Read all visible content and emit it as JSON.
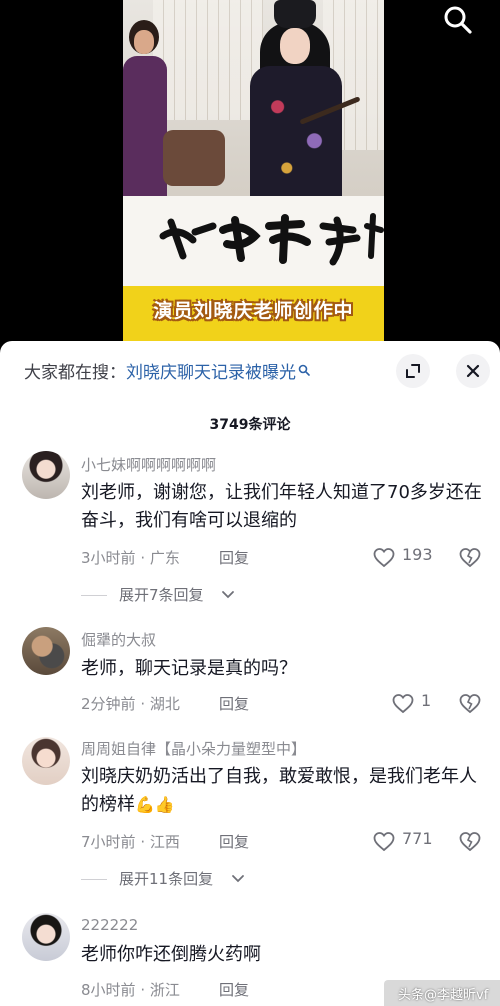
{
  "video": {
    "caption": "演员刘晓庆老师创作中"
  },
  "hot_search": {
    "prefix": "大家都在搜：",
    "topic": "刘晓庆聊天记录被曝光"
  },
  "comment_count": "3749条评论",
  "comments": [
    {
      "username": "小七妹啊啊啊啊啊啊",
      "content": "刘老师，谢谢您，让我们年轻人知道了70多岁还在奋斗，我们有啥可以退缩的",
      "time": "3小时前",
      "location": "广东",
      "reply_label": "回复",
      "likes": "193",
      "expand_label": "展开7条回复"
    },
    {
      "username": "倔犟的大叔",
      "content": "老师，聊天记录是真的吗？",
      "time": "2分钟前",
      "location": "湖北",
      "reply_label": "回复",
      "likes": "1"
    },
    {
      "username": "周周姐自律【晶小朵力量塑型中】",
      "content": "刘晓庆奶奶活出了自我，敢爱敢恨，是我们老年人的榜样",
      "content_emoji": "💪👍",
      "time": "7小时前",
      "location": "江西",
      "reply_label": "回复",
      "likes": "771",
      "expand_label": "展开11条回复"
    },
    {
      "username": "222222",
      "content": "老师你咋还倒腾火药啊",
      "time": "8小时前",
      "location": "浙江",
      "reply_label": "回复"
    }
  ],
  "watermark": "头条@李越昕vf",
  "colors": {
    "link_blue": "#2c62a8",
    "caption_band": "#f1d21a",
    "muted_text": "#8a8b91"
  }
}
